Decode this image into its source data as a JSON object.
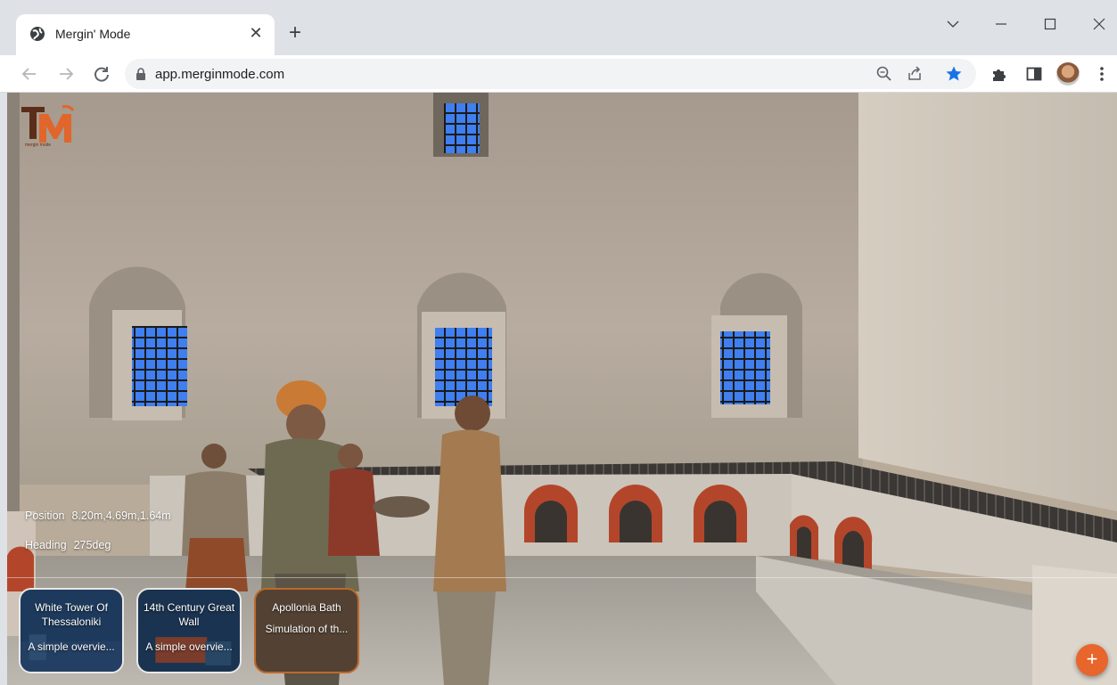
{
  "browser": {
    "tab_title": "Mergin' Mode",
    "tab_close_glyph": "✕",
    "new_tab_glyph": "+",
    "url": "app.merginmode.com",
    "window_controls": {
      "dropdown": "⌵",
      "minimize": "—",
      "maximize": "☐",
      "close": "✕"
    },
    "icons": [
      "globe-icon",
      "back-arrow-icon",
      "forward-arrow-icon",
      "reload-icon",
      "lock-icon",
      "zoom-out-icon",
      "share-icon",
      "bookmark-star-icon",
      "extensions-puzzle-icon",
      "side-panel-icon",
      "profile-avatar",
      "kebab-menu-icon"
    ],
    "star_color": "#1a73e8"
  },
  "hud": {
    "position_label": "Position",
    "position_value": "8.20m,4.69m,1.64m",
    "heading_label": "Heading",
    "heading_value": "275deg"
  },
  "tours": [
    {
      "title": "White Tower Of Thessaloniki",
      "description": "A simple overvie..."
    },
    {
      "title": "14th Century Great Wall",
      "description": "A simple overvie..."
    },
    {
      "title": "Apollonia Bath",
      "description": "Simulation of th..."
    }
  ],
  "fab": {
    "label": "+",
    "color": "#e8652b"
  },
  "logo": {
    "text": "TM",
    "subtext": "mergin mode"
  }
}
